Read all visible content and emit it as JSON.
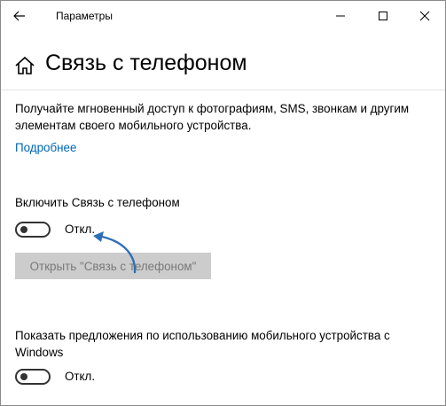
{
  "window": {
    "title": "Параметры",
    "controls": {
      "minimize": "minimize",
      "maximize": "maximize",
      "close": "close"
    }
  },
  "page": {
    "title": "Связь с телефоном",
    "description": "Получайте мгновенный доступ к фотографиям, SMS, звонкам и другим элементам своего мобильного устройства.",
    "learn_more_link": "Подробнее"
  },
  "phone_link_setting": {
    "label": "Включить Связь с телефоном",
    "state": "Откл.",
    "open_button": "Открыть \"Связь с телефоном\""
  },
  "suggestions_setting": {
    "label": "Показать предложения по использованию мобильного устройства с Windows",
    "state": "Откл."
  },
  "colors": {
    "accent": "#0067b8",
    "annotation_arrow": "#2d6fb7",
    "disabled_button_bg": "#cccccc",
    "disabled_button_text": "#7a7a7a"
  }
}
